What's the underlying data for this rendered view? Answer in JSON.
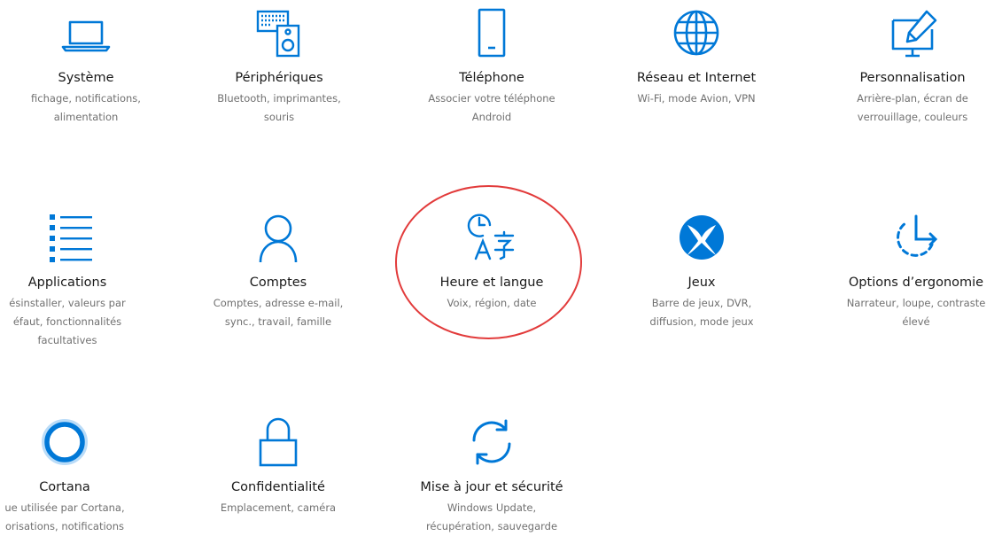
{
  "accent_color": "#0078d7",
  "annotation_color": "#e23b3b",
  "tiles": [
    {
      "id": "systeme",
      "icon": "laptop-icon",
      "title": "Système",
      "desc1": "fichage, notifications,",
      "desc2": "alimentation",
      "desc3": ""
    },
    {
      "id": "peripheriques",
      "icon": "devices-icon",
      "title": "Périphériques",
      "desc1": "Bluetooth, imprimantes,",
      "desc2": "souris",
      "desc3": ""
    },
    {
      "id": "telephone",
      "icon": "phone-icon",
      "title": "Téléphone",
      "desc1": "Associer votre téléphone",
      "desc2": "Android",
      "desc3": ""
    },
    {
      "id": "reseau",
      "icon": "globe-icon",
      "title": "Réseau et Internet",
      "desc1": "Wi-Fi, mode Avion, VPN",
      "desc2": "",
      "desc3": ""
    },
    {
      "id": "personnalisation",
      "icon": "paint-brush-icon",
      "title": "Personnalisation",
      "desc1": "Arrière-plan, écran de",
      "desc2": "verrouillage, couleurs",
      "desc3": ""
    },
    {
      "id": "applications",
      "icon": "app-list-icon",
      "title": "Applications",
      "desc1": "ésinstaller, valeurs par",
      "desc2": "éfaut, fonctionnalités",
      "desc3": "facultatives"
    },
    {
      "id": "comptes",
      "icon": "person-icon",
      "title": "Comptes",
      "desc1": "Comptes, adresse e-mail,",
      "desc2": "sync., travail, famille",
      "desc3": ""
    },
    {
      "id": "heure",
      "icon": "time-language-icon",
      "title": "Heure et langue",
      "desc1": "Voix, région, date",
      "desc2": "",
      "desc3": ""
    },
    {
      "id": "jeux",
      "icon": "xbox-icon",
      "title": "Jeux",
      "desc1": "Barre de jeux, DVR,",
      "desc2": "diffusion, mode jeux",
      "desc3": ""
    },
    {
      "id": "ergonomie",
      "icon": "ease-of-access-icon",
      "title": "Options d’ergonomie",
      "desc1": "Narrateur, loupe, contraste",
      "desc2": "élevé",
      "desc3": ""
    },
    {
      "id": "cortana",
      "icon": "cortana-icon",
      "title": "Cortana",
      "desc1": "ue utilisée par Cortana,",
      "desc2": "orisations, notifications",
      "desc3": ""
    },
    {
      "id": "confidentialite",
      "icon": "lock-icon",
      "title": "Confidentialité",
      "desc1": "Emplacement, caméra",
      "desc2": "",
      "desc3": ""
    },
    {
      "id": "miseajour",
      "icon": "sync-icon",
      "title": "Mise à jour et sécurité",
      "desc1": "Windows Update,",
      "desc2": "récupération, sauvegarde",
      "desc3": ""
    }
  ]
}
